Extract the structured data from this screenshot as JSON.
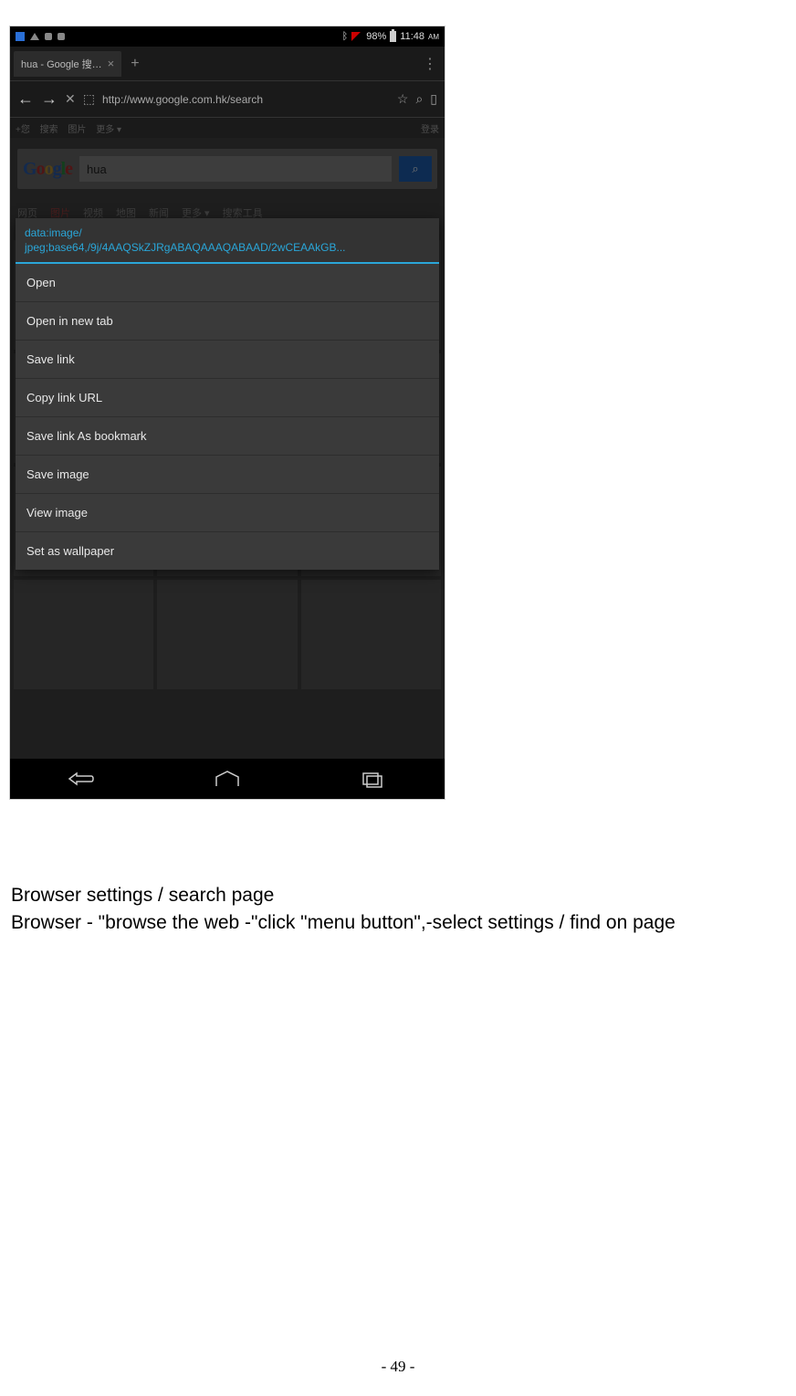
{
  "statusbar": {
    "bt_icon": "bt",
    "signal_pct": "98%",
    "time": "11:48",
    "ampm": "AM"
  },
  "tabrow": {
    "tab_title": "hua - Google 搜…",
    "close": "×",
    "plus": "+",
    "more": "⋮"
  },
  "urlbar": {
    "back": "←",
    "fwd": "→",
    "stop": "✕",
    "globe": "⬚",
    "url": "http://www.google.com.hk/search",
    "star": "☆",
    "search": "⌕",
    "bookmark": "▯"
  },
  "topstrip": {
    "left1": "+您",
    "left2": "搜索",
    "left3": "图片",
    "left4": "更多 ▾",
    "right": "登录"
  },
  "google": {
    "g1": "G",
    "g2": "o",
    "g3": "o",
    "g4": "g",
    "g5": "l",
    "g6": "e",
    "query": "hua",
    "search_icon": "⌕"
  },
  "tabs": {
    "t1": "网页",
    "t2": "图片",
    "t3": "视频",
    "t4": "地图",
    "t5": "新闻",
    "t6": "更多 ▾",
    "t7": "搜索工具"
  },
  "ctx": {
    "header": "data:image/\njpeg;base64,/9j/4AAQSkZJRgABAQAAAQABAAD/2wCEAAkGB...",
    "items": [
      "Open",
      "Open in new tab",
      "Save link",
      "Copy link URL",
      "Save link As bookmark",
      "Save image",
      "View image",
      "Set as wallpaper"
    ]
  },
  "doc": {
    "line1": "Browser settings / search page",
    "line2": "Browser - \"browse the web -\"click \"menu button\",-select settings / find on page"
  },
  "pagenum": "- 49 -"
}
